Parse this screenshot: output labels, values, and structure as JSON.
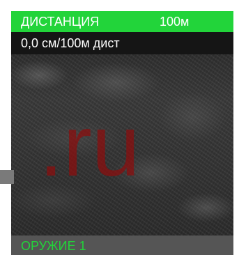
{
  "header": {
    "menu_title": "ДИСТАНЦИЯ",
    "menu_value": "100м"
  },
  "info": {
    "text": "0,0 см/100м дист"
  },
  "footer": {
    "weapon_label": "ОРУЖИЕ 1"
  },
  "watermark": {
    "text": ".ru"
  },
  "colors": {
    "accent_green": "#22d43a",
    "footer_gray": "#555555",
    "info_black": "#151515",
    "watermark_red": "#8a0e0e"
  }
}
